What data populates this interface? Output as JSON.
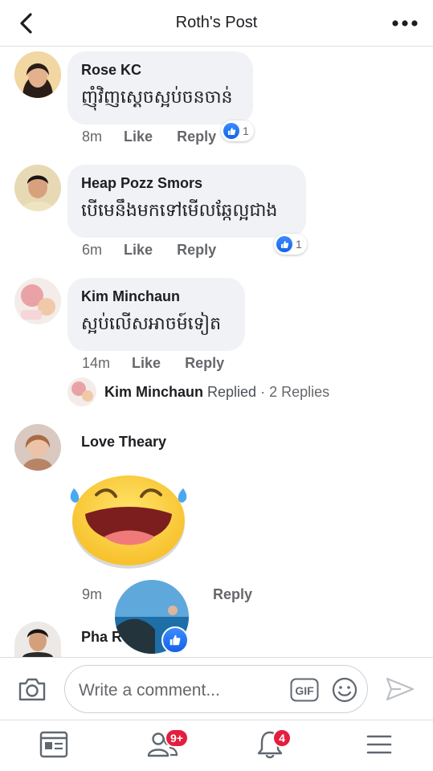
{
  "header": {
    "title": "Roth's Post"
  },
  "comments": [
    {
      "name": "Rose KC",
      "text": "ញុំវិញស្តេចស្អប់ចនចាន់",
      "time": "8m",
      "like_label": "Like",
      "reply_label": "Reply",
      "reaction_count": "1"
    },
    {
      "name": "Heap Pozz Smors",
      "text": "បើមេនឹងមកទៅមើលឆ្កែល្អជាង",
      "time": "6m",
      "like_label": "Like",
      "reply_label": "Reply",
      "reaction_count": "1"
    },
    {
      "name": "Kim Minchaun",
      "text": "ស្អប់លើសអាចម៍ទៀត",
      "time": "14m",
      "like_label": "Like",
      "reply_label": "Reply"
    },
    {
      "name": "Love Theary",
      "time": "9m",
      "reply_label": "Reply"
    },
    {
      "name": "Pha R"
    }
  ],
  "replied": {
    "name": "Kim Minchaun",
    "word": "Replied",
    "separator": "·",
    "count": "2 Replies"
  },
  "composer": {
    "placeholder": "Write a comment...",
    "gif_label": "GIF"
  },
  "tabbar": {
    "friends_badge": "9+",
    "notifications_badge": "4"
  },
  "colors": {
    "accent": "#1877f2",
    "badge": "#e41e3f",
    "bubble": "#f0f2f5",
    "muted": "#65676b"
  }
}
